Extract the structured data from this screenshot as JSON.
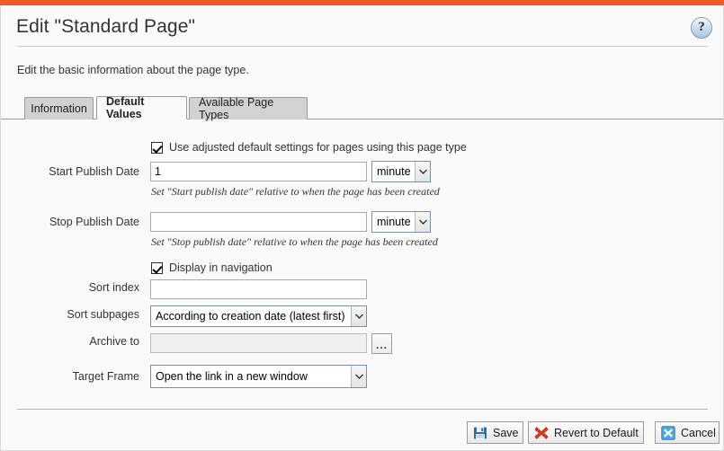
{
  "window": {
    "accent_color": "#f05a28",
    "background": "#fafafa"
  },
  "header": {
    "title": "Edit \"Standard Page\"",
    "intro": "Edit the basic information about the page type.",
    "help_icon": "question-mark-icon",
    "help_glyph": "?"
  },
  "tabs": [
    {
      "label": "Information",
      "active": false
    },
    {
      "label": "Default Values",
      "active": true
    },
    {
      "label": "Available Page Types",
      "active": false
    }
  ],
  "form": {
    "use_adjusted": {
      "label": "Use adjusted default settings for pages using this page type",
      "checked": true
    },
    "start_publish": {
      "label": "Start Publish Date",
      "value": "1",
      "unit": "minute",
      "hint": "Set \"Start publish date\" relative to when the page has been created"
    },
    "stop_publish": {
      "label": "Stop Publish Date",
      "value": "",
      "unit": "minute",
      "hint": "Set \"Stop publish date\" relative to when the page has been created"
    },
    "display_in_navigation": {
      "label": "Display in navigation",
      "checked": true
    },
    "sort_index": {
      "label": "Sort index",
      "value": ""
    },
    "sort_subpages": {
      "label": "Sort subpages",
      "value": "According to creation date (latest first)"
    },
    "archive_to": {
      "label": "Archive to",
      "value": "",
      "disabled": true,
      "browse_label": "..."
    },
    "target_frame": {
      "label": "Target Frame",
      "value": "Open the link in a new window"
    }
  },
  "footer": {
    "buttons": [
      {
        "label": "Save",
        "icon": "floppy-disk-save-icon"
      },
      {
        "label": "Revert to Default",
        "icon": "red-x-revert-icon"
      },
      {
        "label": "Cancel",
        "icon": "blue-x-cancel-icon"
      }
    ]
  }
}
